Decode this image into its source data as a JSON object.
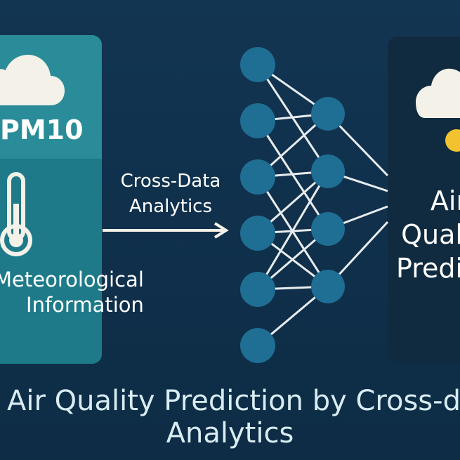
{
  "input_panel": {
    "pollutant_label": "PM10",
    "meteo_label_line1": "Meteorological",
    "meteo_label_line2": "Information"
  },
  "connector": {
    "label_line1": "Cross-Data",
    "label_line2": "Analytics"
  },
  "output_panel": {
    "label_line1": "Air",
    "label_line2": "Quality",
    "label_line3": "Prediction"
  },
  "title": {
    "line1": "Air Quality Prediction by Cross-data",
    "line2": "Analytics"
  },
  "icons": {
    "input_top": "cloud-icon",
    "input_bottom": "thermometer-icon",
    "output_top": "cloud-sun-icon"
  },
  "colors": {
    "background": "#0f2f4a",
    "input_panel": "#2a8c98",
    "output_panel": "#102b40",
    "node": "#1f6e94",
    "line": "#e8ecef",
    "sun": "#f2c230",
    "cloud": "#f3f1e8"
  },
  "network": {
    "layer_sizes": [
      6,
      4
    ]
  }
}
